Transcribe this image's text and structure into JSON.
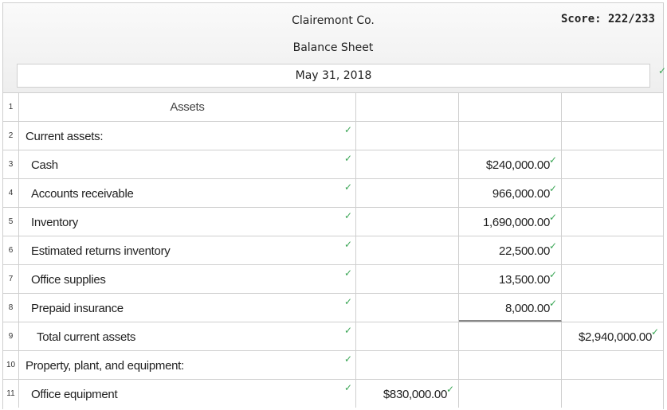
{
  "header": {
    "company": "Clairemont Co.",
    "title": "Balance Sheet",
    "date": "May 31, 2018",
    "score": "Score: 222/233"
  },
  "check_glyph": "✓",
  "check_color": "#3aa655",
  "rows": [
    {
      "num": "1",
      "label": "Assets",
      "col2": "",
      "col3": "",
      "col4": ""
    },
    {
      "num": "2",
      "label": "Current assets:",
      "col2": "",
      "col3": "",
      "col4": ""
    },
    {
      "num": "3",
      "label": "Cash",
      "col2": "",
      "col3": "$240,000.00",
      "col4": ""
    },
    {
      "num": "4",
      "label": "Accounts receivable",
      "col2": "",
      "col3": "966,000.00",
      "col4": ""
    },
    {
      "num": "5",
      "label": "Inventory",
      "col2": "",
      "col3": "1,690,000.00",
      "col4": ""
    },
    {
      "num": "6",
      "label": "Estimated returns inventory",
      "col2": "",
      "col3": "22,500.00",
      "col4": ""
    },
    {
      "num": "7",
      "label": "Office supplies",
      "col2": "",
      "col3": "13,500.00",
      "col4": ""
    },
    {
      "num": "8",
      "label": "Prepaid insurance",
      "col2": "",
      "col3": "8,000.00",
      "col4": ""
    },
    {
      "num": "9",
      "label": "Total current assets",
      "col2": "",
      "col3": "",
      "col4": "$2,940,000.00"
    },
    {
      "num": "10",
      "label": "Property, plant, and equipment:",
      "col2": "",
      "col3": "",
      "col4": ""
    },
    {
      "num": "11",
      "label": "Office equipment",
      "col2": "$830,000.00",
      "col3": "",
      "col4": ""
    }
  ]
}
